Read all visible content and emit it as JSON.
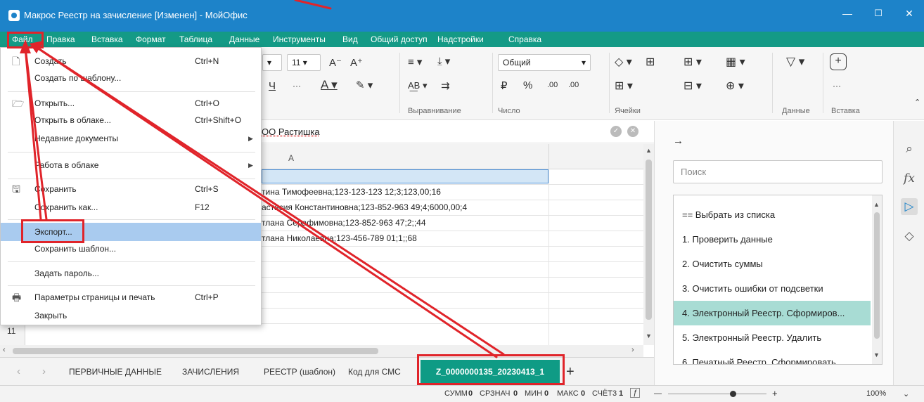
{
  "window": {
    "title": "Макрос Реестр на зачисление [Изменен] - МойОфис",
    "minimize": "—",
    "maximize": "☐",
    "close": "✕"
  },
  "menubar": [
    "Файл",
    "Правка",
    "Вставка",
    "Формат",
    "Таблица",
    "Данные",
    "Инструменты",
    "Вид",
    "Общий доступ",
    "Надстройки",
    "Справка"
  ],
  "ribbon": {
    "font_size": "11",
    "number_format": "Общий",
    "groups": {
      "alignment": "Выравнивание",
      "number": "Число",
      "cells": "Ячейки",
      "data": "Данные",
      "insert": "Вставка"
    }
  },
  "formula_bar": {
    "text": "ОО Растишка"
  },
  "sheet": {
    "column_header": "A",
    "row_number": "11",
    "rows": [
      "тина Тимофеевна;123-123-123 12;3;123,00;16",
      "астасия Константиновна;123-852-963 49;4;6000,00;4",
      "тлана Серафимовна;123-852-963 47;2;;44",
      "тлана Николаевна;123-456-789 01;1;;68"
    ]
  },
  "file_menu": {
    "items": [
      {
        "label": "Создать",
        "shortcut": "Ctrl+N",
        "icon": "new-document-icon"
      },
      {
        "label": "Создать по шаблону...",
        "shortcut": ""
      },
      {
        "label": "Открыть...",
        "shortcut": "Ctrl+O",
        "icon": "folder-icon"
      },
      {
        "label": "Открыть в облаке...",
        "shortcut": "Ctrl+Shift+O"
      },
      {
        "label": "Недавние документы",
        "shortcut": "",
        "submenu": true
      },
      {
        "label": "Работа в облаке",
        "shortcut": "",
        "submenu": true
      },
      {
        "label": "Сохранить",
        "shortcut": "Ctrl+S",
        "icon": "save-icon"
      },
      {
        "label": "Сохранить как...",
        "shortcut": "F12"
      },
      {
        "label": "Экспорт...",
        "shortcut": "",
        "highlighted": true
      },
      {
        "label": "Сохранить шаблон...",
        "shortcut": ""
      },
      {
        "label": "Задать пароль...",
        "shortcut": ""
      },
      {
        "label": "Параметры страницы и печать",
        "shortcut": "Ctrl+P",
        "icon": "printer-icon"
      },
      {
        "label": "Закрыть",
        "shortcut": ""
      }
    ]
  },
  "tabs": {
    "prev": "‹",
    "next": "›",
    "items": [
      "ПЕРВИЧНЫЕ ДАННЫЕ",
      "ЗАЧИСЛЕНИЯ",
      "РЕЕСТР (шаблон)",
      "Код для СМС",
      "Z_0000000135_20230413_1"
    ],
    "add": "+"
  },
  "side_panel": {
    "search_placeholder": "Поиск",
    "items": [
      "== Выбрать из списка",
      "1. Проверить данные",
      "2. Очистить суммы",
      "3. Очистить ошибки от подсветки",
      "4. Электронный Реестр. Сформиров...",
      "5. Электронный Реестр. Удалить",
      "6. Печатный Реестр. Сформировать"
    ]
  },
  "statusbar": {
    "sum": "СУММ",
    "sum_v": "0",
    "avg": "СРЗНАЧ",
    "avg_v": "0",
    "min": "МИН",
    "min_v": "0",
    "max": "МАКС",
    "max_v": "0",
    "count": "СЧЁТ3",
    "count_v": "1",
    "zoom": "100%"
  },
  "colors": {
    "titlebar": "#1d83c9",
    "menubar": "#149a86",
    "active_tab": "#0f9b85",
    "annotation": "#e0242a",
    "selected_item": "#a8dcd4",
    "highlight": "#a9cbef"
  }
}
